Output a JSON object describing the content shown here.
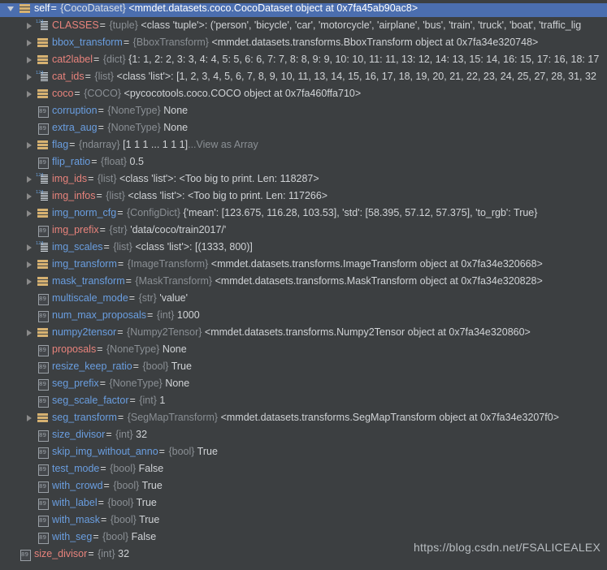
{
  "panel": {
    "title": "Debugger Variables",
    "watermark": "https://blog.csdn.net/FSALICEALEX",
    "colors": {
      "background": "#3c3f41",
      "selection": "#4b6eaf",
      "name_red": "#e8837c",
      "name_blue": "#6a9ee0",
      "type_gray": "#8a8f94",
      "value_gray": "#d0d3d6",
      "icon_tan": "#d6b171"
    }
  },
  "rows": [
    {
      "indent": 0,
      "twisty": "expanded",
      "icon": "object",
      "selected": true,
      "name": "self",
      "name_color": "red",
      "eq": "=",
      "type": "{CocoDataset}",
      "value": "<mmdet.datasets.coco.CocoDataset object at 0x7fa45ab90ac8>"
    },
    {
      "indent": 1,
      "twisty": "collapsed",
      "icon": "list",
      "selected": false,
      "name": "CLASSES",
      "name_color": "red",
      "eq": "=",
      "type": "{tuple}",
      "value": "<class 'tuple'>: ('person', 'bicycle', 'car', 'motorcycle', 'airplane', 'bus', 'train', 'truck', 'boat', 'traffic_lig"
    },
    {
      "indent": 1,
      "twisty": "collapsed",
      "icon": "object",
      "selected": false,
      "name": "bbox_transform",
      "name_color": "blue",
      "eq": "=",
      "type": "{BboxTransform}",
      "value": "<mmdet.datasets.transforms.BboxTransform object at 0x7fa34e320748>"
    },
    {
      "indent": 1,
      "twisty": "collapsed",
      "icon": "object",
      "selected": false,
      "name": "cat2label",
      "name_color": "red",
      "eq": "=",
      "type": "{dict}",
      "value": "{1: 1, 2: 2, 3: 3, 4: 4, 5: 5, 6: 6, 7: 7, 8: 8, 9: 9, 10: 10, 11: 11, 13: 12, 14: 13, 15: 14, 16: 15, 17: 16, 18: 17"
    },
    {
      "indent": 1,
      "twisty": "collapsed",
      "icon": "list",
      "selected": false,
      "name": "cat_ids",
      "name_color": "red",
      "eq": "=",
      "type": "{list}",
      "value": "<class 'list'>: [1, 2, 3, 4, 5, 6, 7, 8, 9, 10, 11, 13, 14, 15, 16, 17, 18, 19, 20, 21, 22, 23, 24, 25, 27, 28, 31, 32"
    },
    {
      "indent": 1,
      "twisty": "collapsed",
      "icon": "object",
      "selected": false,
      "name": "coco",
      "name_color": "red",
      "eq": "=",
      "type": "{COCO}",
      "value": "<pycocotools.coco.COCO object at 0x7fa460ffa710>"
    },
    {
      "indent": 1,
      "twisty": "none",
      "icon": "primitive",
      "selected": false,
      "name": "corruption",
      "name_color": "blue",
      "eq": "=",
      "type": "{NoneType}",
      "value": "None"
    },
    {
      "indent": 1,
      "twisty": "none",
      "icon": "primitive",
      "selected": false,
      "name": "extra_aug",
      "name_color": "blue",
      "eq": "=",
      "type": "{NoneType}",
      "value": "None"
    },
    {
      "indent": 1,
      "twisty": "collapsed",
      "icon": "object",
      "selected": false,
      "name": "flag",
      "name_color": "blue",
      "eq": "=",
      "type": "{ndarray}",
      "value": "[1 1 1 ... 1 1 1]",
      "extra": "...View as Array"
    },
    {
      "indent": 1,
      "twisty": "none",
      "icon": "primitive",
      "selected": false,
      "name": "flip_ratio",
      "name_color": "blue",
      "eq": "=",
      "type": "{float}",
      "value": "0.5"
    },
    {
      "indent": 1,
      "twisty": "collapsed",
      "icon": "list",
      "selected": false,
      "name": "img_ids",
      "name_color": "red",
      "eq": "=",
      "type": "{list}",
      "value": "<class 'list'>: <Too big to print. Len: 118287>"
    },
    {
      "indent": 1,
      "twisty": "collapsed",
      "icon": "list",
      "selected": false,
      "name": "img_infos",
      "name_color": "red",
      "eq": "=",
      "type": "{list}",
      "value": "<class 'list'>: <Too big to print. Len: 117266>"
    },
    {
      "indent": 1,
      "twisty": "collapsed",
      "icon": "object",
      "selected": false,
      "name": "img_norm_cfg",
      "name_color": "blue",
      "eq": "=",
      "type": "{ConfigDict}",
      "value": "{'mean': [123.675, 116.28, 103.53], 'std': [58.395, 57.12, 57.375], 'to_rgb': True}"
    },
    {
      "indent": 1,
      "twisty": "none",
      "icon": "primitive",
      "selected": false,
      "name": "img_prefix",
      "name_color": "red",
      "eq": "=",
      "type": "{str}",
      "value": "'data/coco/train2017/'"
    },
    {
      "indent": 1,
      "twisty": "collapsed",
      "icon": "list",
      "selected": false,
      "name": "img_scales",
      "name_color": "blue",
      "eq": "=",
      "type": "{list}",
      "value": "<class 'list'>: [(1333, 800)]"
    },
    {
      "indent": 1,
      "twisty": "collapsed",
      "icon": "object",
      "selected": false,
      "name": "img_transform",
      "name_color": "blue",
      "eq": "=",
      "type": "{ImageTransform}",
      "value": "<mmdet.datasets.transforms.ImageTransform object at 0x7fa34e320668>"
    },
    {
      "indent": 1,
      "twisty": "collapsed",
      "icon": "object",
      "selected": false,
      "name": "mask_transform",
      "name_color": "blue",
      "eq": "=",
      "type": "{MaskTransform}",
      "value": "<mmdet.datasets.transforms.MaskTransform object at 0x7fa34e320828>"
    },
    {
      "indent": 1,
      "twisty": "none",
      "icon": "primitive",
      "selected": false,
      "name": "multiscale_mode",
      "name_color": "blue",
      "eq": "=",
      "type": "{str}",
      "value": "'value'"
    },
    {
      "indent": 1,
      "twisty": "none",
      "icon": "primitive",
      "selected": false,
      "name": "num_max_proposals",
      "name_color": "blue",
      "eq": "=",
      "type": "{int}",
      "value": "1000"
    },
    {
      "indent": 1,
      "twisty": "collapsed",
      "icon": "object",
      "selected": false,
      "name": "numpy2tensor",
      "name_color": "blue",
      "eq": "=",
      "type": "{Numpy2Tensor}",
      "value": "<mmdet.datasets.transforms.Numpy2Tensor object at 0x7fa34e320860>"
    },
    {
      "indent": 1,
      "twisty": "none",
      "icon": "primitive",
      "selected": false,
      "name": "proposals",
      "name_color": "red",
      "eq": "=",
      "type": "{NoneType}",
      "value": "None"
    },
    {
      "indent": 1,
      "twisty": "none",
      "icon": "primitive",
      "selected": false,
      "name": "resize_keep_ratio",
      "name_color": "blue",
      "eq": "=",
      "type": "{bool}",
      "value": "True"
    },
    {
      "indent": 1,
      "twisty": "none",
      "icon": "primitive",
      "selected": false,
      "name": "seg_prefix",
      "name_color": "blue",
      "eq": "=",
      "type": "{NoneType}",
      "value": "None"
    },
    {
      "indent": 1,
      "twisty": "none",
      "icon": "primitive",
      "selected": false,
      "name": "seg_scale_factor",
      "name_color": "blue",
      "eq": "=",
      "type": "{int}",
      "value": "1"
    },
    {
      "indent": 1,
      "twisty": "collapsed",
      "icon": "object",
      "selected": false,
      "name": "seg_transform",
      "name_color": "blue",
      "eq": "=",
      "type": "{SegMapTransform}",
      "value": "<mmdet.datasets.transforms.SegMapTransform object at 0x7fa34e3207f0>"
    },
    {
      "indent": 1,
      "twisty": "none",
      "icon": "primitive",
      "selected": false,
      "name": "size_divisor",
      "name_color": "blue",
      "eq": "=",
      "type": "{int}",
      "value": "32"
    },
    {
      "indent": 1,
      "twisty": "none",
      "icon": "primitive",
      "selected": false,
      "name": "skip_img_without_anno",
      "name_color": "blue",
      "eq": "=",
      "type": "{bool}",
      "value": "True"
    },
    {
      "indent": 1,
      "twisty": "none",
      "icon": "primitive",
      "selected": false,
      "name": "test_mode",
      "name_color": "blue",
      "eq": "=",
      "type": "{bool}",
      "value": "False"
    },
    {
      "indent": 1,
      "twisty": "none",
      "icon": "primitive",
      "selected": false,
      "name": "with_crowd",
      "name_color": "blue",
      "eq": "=",
      "type": "{bool}",
      "value": "True"
    },
    {
      "indent": 1,
      "twisty": "none",
      "icon": "primitive",
      "selected": false,
      "name": "with_label",
      "name_color": "blue",
      "eq": "=",
      "type": "{bool}",
      "value": "True"
    },
    {
      "indent": 1,
      "twisty": "none",
      "icon": "primitive",
      "selected": false,
      "name": "with_mask",
      "name_color": "blue",
      "eq": "=",
      "type": "{bool}",
      "value": "True"
    },
    {
      "indent": 1,
      "twisty": "none",
      "icon": "primitive",
      "selected": false,
      "name": "with_seg",
      "name_color": "blue",
      "eq": "=",
      "type": "{bool}",
      "value": "False"
    },
    {
      "indent": 0,
      "twisty": "none",
      "icon": "primitive",
      "selected": false,
      "name": "size_divisor",
      "name_color": "red",
      "eq": "=",
      "type": "{int}",
      "value": "32"
    }
  ]
}
